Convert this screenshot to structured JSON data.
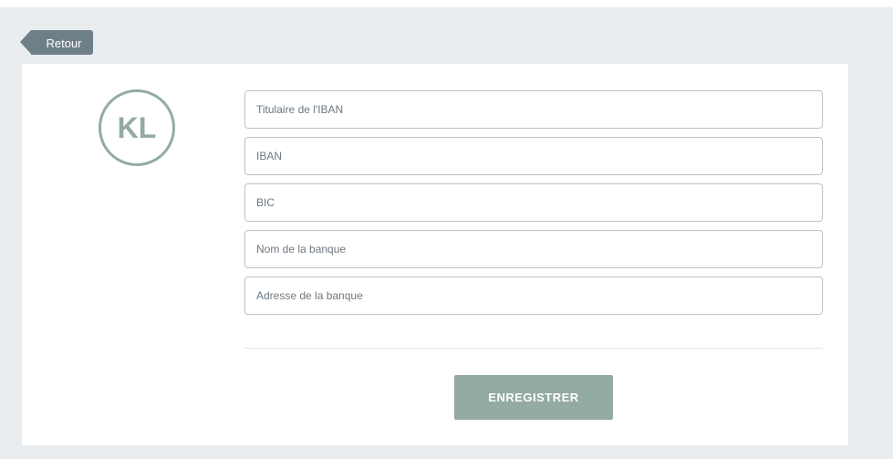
{
  "header": {
    "back_label": "Retour"
  },
  "profile": {
    "initials": "KL"
  },
  "form": {
    "fields": [
      {
        "placeholder": "Titulaire de l'IBAN",
        "value": ""
      },
      {
        "placeholder": "IBAN",
        "value": ""
      },
      {
        "placeholder": "BIC",
        "value": ""
      },
      {
        "placeholder": "Nom de la banque",
        "value": ""
      },
      {
        "placeholder": "Adresse de la banque",
        "value": ""
      }
    ],
    "submit_label": "ENREGISTRER"
  },
  "colors": {
    "accent": "#93aba2",
    "back_button": "#6f7f88",
    "background": "#e9edf0"
  }
}
